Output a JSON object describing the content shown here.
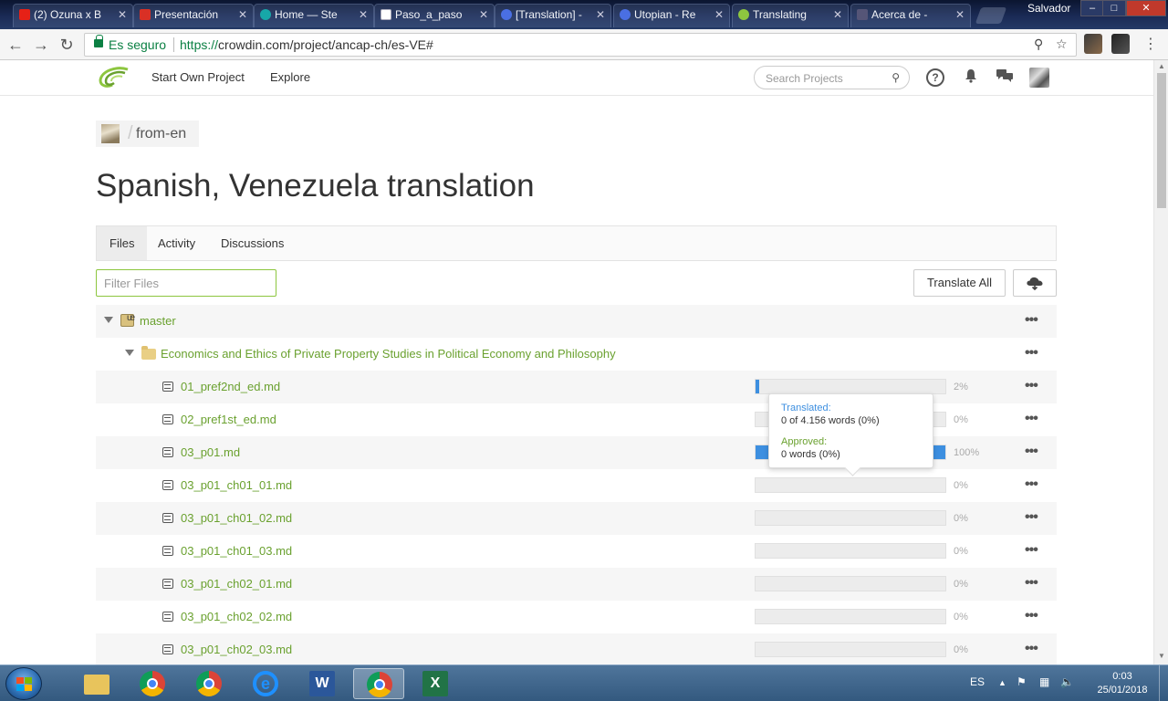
{
  "browser": {
    "tabs": [
      {
        "title": "(2) Ozuna x B",
        "color": "#e62117"
      },
      {
        "title": "Presentación",
        "color": "#d93025"
      },
      {
        "title": "Home — Ste",
        "color": "#17a7a8"
      },
      {
        "title": "Paso_a_paso",
        "color": "#ffffff"
      },
      {
        "title": "[Translation] -",
        "color": "#4a6fe3"
      },
      {
        "title": "Utopian - Re",
        "color": "#4a6fe3"
      },
      {
        "title": "Translating",
        "color": "#8dc63f"
      },
      {
        "title": "Acerca de -",
        "color": "#555577"
      }
    ],
    "profile_name": "Salvador",
    "window_controls": {
      "minimize": "–",
      "maximize": "□",
      "close": "✕"
    },
    "secure_label": "Es seguro",
    "url_scheme": "https://",
    "url_rest": "crowdin.com/project/ancap-ch/es-VE#"
  },
  "header": {
    "nav": [
      "Start Own Project",
      "Explore"
    ],
    "search_placeholder": "Search Projects",
    "help_glyph": "?"
  },
  "page": {
    "breadcrumb": "from-en",
    "title": "Spanish, Venezuela translation",
    "tabs": [
      "Files",
      "Activity",
      "Discussions"
    ],
    "active_tab": "Files",
    "filter_placeholder": "Filter Files",
    "translate_all": "Translate All"
  },
  "tree": {
    "branch": "master",
    "folder": "Economics and Ethics of Private Property Studies in Political Economy and Philosophy",
    "files": [
      {
        "name": "01_pref2nd_ed.md",
        "percent": "2%",
        "progress": 0.02
      },
      {
        "name": "02_pref1st_ed.md",
        "percent": "0%",
        "progress": 0
      },
      {
        "name": "03_p01.md",
        "percent": "100%",
        "progress": 1.0
      },
      {
        "name": "03_p01_ch01_01.md",
        "percent": "0%",
        "progress": 0
      },
      {
        "name": "03_p01_ch01_02.md",
        "percent": "0%",
        "progress": 0
      },
      {
        "name": "03_p01_ch01_03.md",
        "percent": "0%",
        "progress": 0
      },
      {
        "name": "03_p01_ch02_01.md",
        "percent": "0%",
        "progress": 0
      },
      {
        "name": "03_p01_ch02_02.md",
        "percent": "0%",
        "progress": 0
      },
      {
        "name": "03_p01_ch02_03.md",
        "percent": "0%",
        "progress": 0
      }
    ],
    "more_glyph": "•••"
  },
  "tooltip": {
    "translated_label": "Translated:",
    "translated_value": "0 of 4.156 words (0%)",
    "approved_label": "Approved:",
    "approved_value": "0 words (0%)"
  },
  "taskbar": {
    "language": "ES",
    "time": "0:03",
    "date": "25/01/2018",
    "apps": [
      "file-explorer",
      "chrome",
      "chrome",
      "internet-explorer",
      "word",
      "chrome",
      "excel"
    ],
    "word_letter": "W",
    "excel_letter": "X",
    "ie_letter": "e"
  },
  "colors": {
    "accent_green": "#8dc63f",
    "link_green": "#6aa12f",
    "progress_blue": "#3d8fe0"
  }
}
